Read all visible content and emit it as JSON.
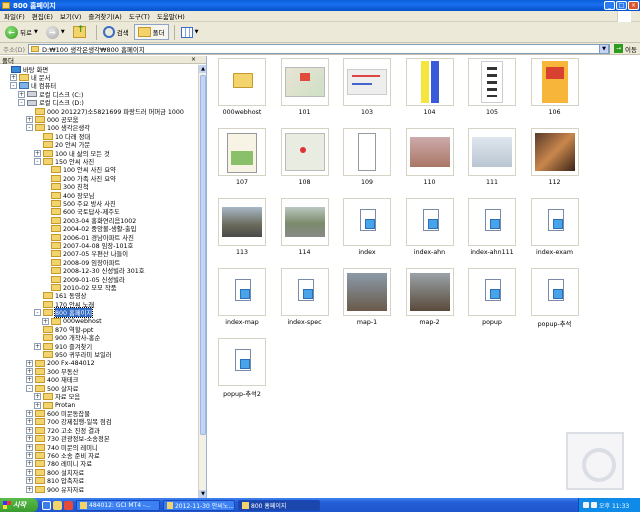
{
  "window": {
    "title": "800 홈페이지"
  },
  "menu": [
    "파일(F)",
    "편집(E)",
    "보기(V)",
    "즐겨찾기(A)",
    "도구(T)",
    "도움말(H)"
  ],
  "toolbar": {
    "back": "뒤로",
    "search": "검색",
    "folders": "폴더"
  },
  "address": {
    "label": "주소(D)",
    "value": "D:₩100 생각은생각₩800 홈페이지",
    "go": "이동"
  },
  "tree": {
    "header": "폴더",
    "close": "×",
    "nodes": [
      {
        "label": "바탕 화면",
        "pm": "",
        "icon": "dt"
      },
      {
        "label": "내 문서",
        "pm": "+",
        "icon": "fo"
      },
      {
        "label": "내 컴퓨터",
        "pm": "-",
        "icon": "pc"
      },
      {
        "label": "로컬 디스크 (C:)",
        "pm": "+",
        "icon": "dr"
      },
      {
        "label": "로컬 디스크 (D:)",
        "pm": "-",
        "icon": "dr"
      },
      {
        "label": "000 201227)소5821699 파랑드러 머머금 1000",
        "pm": "",
        "icon": "fo"
      },
      {
        "label": "000 공모움",
        "pm": "+",
        "icon": "fo"
      },
      {
        "label": "100 생각은생각",
        "pm": "-",
        "icon": "fo"
      },
      {
        "label": "10 다래 정대",
        "pm": "",
        "icon": "fo"
      },
      {
        "label": "20 안씨 가문",
        "pm": "",
        "icon": "fo"
      },
      {
        "label": "100 내 삶의 모든 것",
        "pm": "+",
        "icon": "fo"
      },
      {
        "label": "150 안씨 사진",
        "pm": "-",
        "icon": "fo"
      },
      {
        "label": "100 안씨 사진 요약",
        "pm": "",
        "icon": "fo"
      },
      {
        "label": "200 가족 사진 요약",
        "pm": "",
        "icon": "fo"
      },
      {
        "label": "300 친척",
        "pm": "",
        "icon": "fo"
      },
      {
        "label": "400 장모님",
        "pm": "",
        "icon": "fo"
      },
      {
        "label": "500 주요 방사 사진",
        "pm": "",
        "icon": "fo"
      },
      {
        "label": "600 국토답사-제주도",
        "pm": "",
        "icon": "fo"
      },
      {
        "label": "2003-04 홍화연리음1002",
        "pm": "",
        "icon": "fo"
      },
      {
        "label": "2004-02 중앙볼-생활-출입",
        "pm": "",
        "icon": "fo"
      },
      {
        "label": "2006-01 경남아파트 사진",
        "pm": "",
        "icon": "fo"
      },
      {
        "label": "2007-04-08 임장-101호",
        "pm": "",
        "icon": "fo"
      },
      {
        "label": "2007-05 우편산 나들이",
        "pm": "",
        "icon": "fo"
      },
      {
        "label": "2008-09 임장아파트",
        "pm": "",
        "icon": "fo"
      },
      {
        "label": "2008-12-30 신성빌라 301호",
        "pm": "",
        "icon": "fo"
      },
      {
        "label": "2009-01-05 신성빌라",
        "pm": "",
        "icon": "fo"
      },
      {
        "label": "2010-02 모모 작품",
        "pm": "",
        "icon": "fo"
      },
      {
        "label": "161 동영상",
        "pm": "",
        "icon": "fo"
      },
      {
        "label": "170 안씨 노래",
        "pm": "",
        "icon": "fo"
      },
      {
        "label": "800 홈페이지",
        "pm": "-",
        "icon": "fo",
        "selected": true
      },
      {
        "label": "000webhost",
        "pm": "+",
        "icon": "fo"
      },
      {
        "label": "870 역할-ppt",
        "pm": "",
        "icon": "fo"
      },
      {
        "label": "900 개작사-홍순",
        "pm": "",
        "icon": "fo"
      },
      {
        "label": "910 즐겨찾기",
        "pm": "+",
        "icon": "fo"
      },
      {
        "label": "950 귀뚜라미 보일러",
        "pm": "",
        "icon": "fo"
      },
      {
        "label": "200 Fx-484012",
        "pm": "+",
        "icon": "fo"
      },
      {
        "label": "300 부동산",
        "pm": "+",
        "icon": "fo"
      },
      {
        "label": "400 재테크",
        "pm": "+",
        "icon": "fo"
      },
      {
        "label": "500 살자료",
        "pm": "-",
        "icon": "fo"
      },
      {
        "label": "자료 모음",
        "pm": "+",
        "icon": "fo"
      },
      {
        "label": "Protan",
        "pm": "+",
        "icon": "fo"
      },
      {
        "label": "600 미문동잡물",
        "pm": "+",
        "icon": "fo"
      },
      {
        "label": "700 강제집행-일목 점검",
        "pm": "+",
        "icon": "fo"
      },
      {
        "label": "720 고소 진정 결과",
        "pm": "+",
        "icon": "fo"
      },
      {
        "label": "730 관광정보-소송정본",
        "pm": "+",
        "icon": "fo"
      },
      {
        "label": "740 미문의 레미니",
        "pm": "+",
        "icon": "fo"
      },
      {
        "label": "760 소송 준비 자료",
        "pm": "+",
        "icon": "fo"
      },
      {
        "label": "780 레미니 자료",
        "pm": "+",
        "icon": "fo"
      },
      {
        "label": "800 설치자료",
        "pm": "+",
        "icon": "fo"
      },
      {
        "label": "810 압축자료",
        "pm": "+",
        "icon": "fo"
      },
      {
        "label": "900 유자자료",
        "pm": "+",
        "icon": "fo"
      }
    ]
  },
  "files": [
    {
      "name": "000webhost",
      "kind": "folder"
    },
    {
      "name": "101",
      "kind": "map"
    },
    {
      "name": "103",
      "kind": "map2"
    },
    {
      "name": "104",
      "kind": "sign-yellow"
    },
    {
      "name": "105",
      "kind": "sign-white"
    },
    {
      "name": "106",
      "kind": "sign-orange"
    },
    {
      "name": "107",
      "kind": "flyer"
    },
    {
      "name": "108",
      "kind": "map3"
    },
    {
      "name": "109",
      "kind": "sketch"
    },
    {
      "name": "110",
      "kind": "baby"
    },
    {
      "name": "111",
      "kind": "baby2"
    },
    {
      "name": "112",
      "kind": "painting"
    },
    {
      "name": "113",
      "kind": "street"
    },
    {
      "name": "114",
      "kind": "road"
    },
    {
      "name": "index",
      "kind": "doc"
    },
    {
      "name": "index-ahn",
      "kind": "doc"
    },
    {
      "name": "index-ahn111",
      "kind": "doc"
    },
    {
      "name": "index-exam",
      "kind": "doc"
    },
    {
      "name": "index-map",
      "kind": "doc"
    },
    {
      "name": "index-spec",
      "kind": "doc"
    },
    {
      "name": "map-1",
      "kind": "building"
    },
    {
      "name": "map-2",
      "kind": "building2"
    },
    {
      "name": "popup",
      "kind": "doc"
    },
    {
      "name": "popup-추석",
      "kind": "doc"
    },
    {
      "name": "popup-추석2",
      "kind": "doc"
    }
  ],
  "taskbar": {
    "start": "시작",
    "items": [
      "484012: GCI MT4 -...",
      "2012-11-30 안씨노...",
      "800 홈페이지"
    ],
    "clock": "오후 11:33"
  }
}
